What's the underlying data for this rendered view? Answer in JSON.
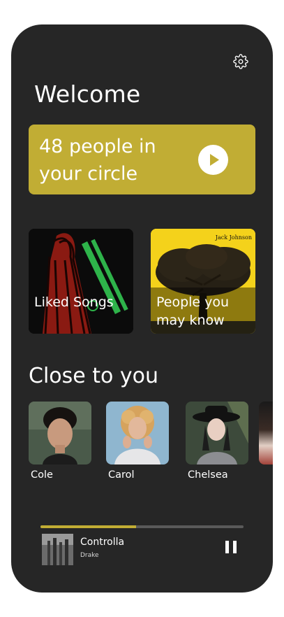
{
  "welcome": {
    "title": "Welcome"
  },
  "circle": {
    "text": "48 people in your circle"
  },
  "tiles": [
    {
      "label": "Liked Songs"
    },
    {
      "label": "People you may know",
      "album_artist": "Jack Johnson"
    }
  ],
  "close_to_you": {
    "title": "Close to you",
    "people": [
      {
        "name": "Cole"
      },
      {
        "name": "Carol"
      },
      {
        "name": "Chelsea"
      }
    ]
  },
  "now_playing": {
    "title": "Controlla",
    "artist": "Drake",
    "progress": 0.47
  },
  "colors": {
    "background": "#262626",
    "accent": "#c1ad34",
    "track": "#5a5a5a"
  },
  "icons": {
    "settings": "gear-icon",
    "play": "play-icon",
    "pause": "pause-icon"
  }
}
